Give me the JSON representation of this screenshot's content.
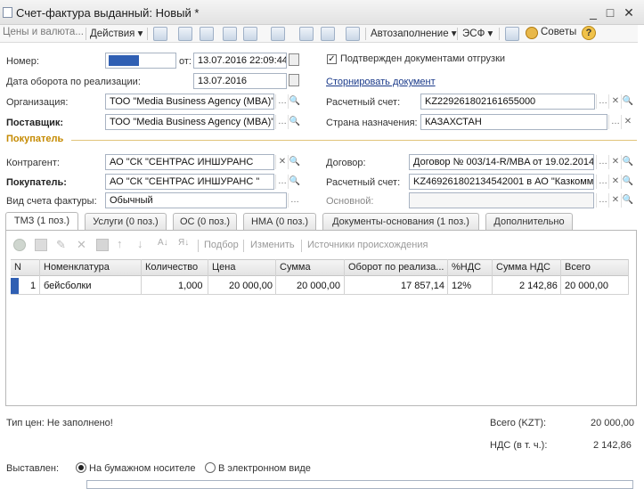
{
  "window": {
    "title": "Счет-фактура выданный: Новый *",
    "controls": [
      "_",
      "□",
      "✕"
    ]
  },
  "toolbar": {
    "prices": "Цены и валюта...",
    "actions": "Действия ▾",
    "autofill": "Автозаполнение ▾",
    "esf": "ЭСФ ▾",
    "tips": "Советы",
    "help": "?"
  },
  "header": {
    "number_label": "Номер:",
    "date_from_label": "от:",
    "date_value": "13.07.2016 22:09:44",
    "turnover_label": "Дата оборота по реализации:",
    "turnover_value": "13.07.2016",
    "confirmed_label": "Подтвержден документами отгрузки",
    "reverse_link": "Сторнировать документ",
    "org_label": "Организация:",
    "org_value": "ТОО \"Media Business Agency (MBA)\"",
    "account_label": "Расчетный счет:",
    "account_value": "KZ229261802161655000",
    "supplier_label": "Поставщик:",
    "supplier_value": "ТОО \"Media Business Agency (MBA)\"",
    "country_label": "Страна назначения:",
    "country_value": "КАЗАХСТАН",
    "buyer_section": "Покупатель",
    "contragent_label": "Контрагент:",
    "contragent_value": "АО   \"СК   \"СЕНТРАС ИНШУРАНС",
    "contract_label": "Договор:",
    "contract_value": "Договор № 003/14-R/MBA от 19.02.2014",
    "buyer_label": "Покупатель:",
    "buyer_value": "АО   \"СК   \"СЕНТРАС ИНШУРАНС \"",
    "buyer_account_label": "Расчетный счет:",
    "buyer_account_value": "KZ469261802134542001 в АО \"Казкомм",
    "invoice_type_label": "Вид счета фактуры:",
    "invoice_type_value": "Обычный",
    "main_label": "Основной:"
  },
  "tabs": [
    {
      "label": "ТМЗ (1 поз.)"
    },
    {
      "label": "Услуги (0 поз.)"
    },
    {
      "label": "ОС (0 поз.)"
    },
    {
      "label": "НМА (0 поз.)"
    },
    {
      "label": "Документы-основания (1 поз.)"
    },
    {
      "label": "Дополнительно"
    }
  ],
  "grid_toolbar": {
    "select": "Подбор",
    "change": "Изменить",
    "sources": "Источники происхождения"
  },
  "table": {
    "columns": [
      "N",
      "Номенклатура",
      "Количество",
      "Цена",
      "Сумма",
      "Оборот по реализа...",
      "%НДС",
      "Сумма НДС",
      "Всего"
    ],
    "rows": [
      {
        "n": "1",
        "item": "бейсболки",
        "qty": "1,000",
        "price": "20 000,00",
        "sum": "20 000,00",
        "turnover": "17 857,14",
        "vat_rate": "12%",
        "vat_sum": "2 142,86",
        "total": "20 000,00"
      }
    ]
  },
  "footer": {
    "price_type": "Тип цен: Не заполнено!",
    "total_label": "Всего (KZT):",
    "total_value": "20 000,00",
    "vat_label": "НДС (в т. ч.):",
    "vat_value": "2 142,86",
    "issued_label": "Выставлен:",
    "paper_option": "На бумажном носителе",
    "electronic_option": "В электронном виде"
  },
  "colors": {
    "section_accent": "#c58a00",
    "selection": "#2f5fb3",
    "link": "#1a3a8a"
  }
}
